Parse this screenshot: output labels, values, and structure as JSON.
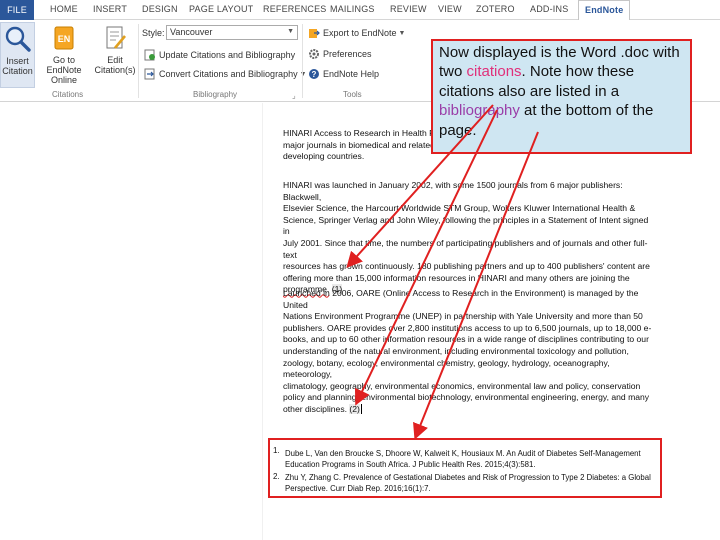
{
  "ribbon": {
    "tabs": [
      {
        "label": "FILE"
      },
      {
        "label": "HOME"
      },
      {
        "label": "INSERT"
      },
      {
        "label": "DESIGN"
      },
      {
        "label": "PAGE LAYOUT"
      },
      {
        "label": "REFERENCES"
      },
      {
        "label": "MAILINGS"
      },
      {
        "label": "REVIEW"
      },
      {
        "label": "VIEW"
      },
      {
        "label": "ZOTERO"
      },
      {
        "label": "ADD-INS"
      },
      {
        "label": "EndNote"
      }
    ],
    "insert_citation": "Insert Citation",
    "goto_endnote": "Go to EndNote Online",
    "edit_citation": "Edit Citation(s)",
    "citations_group": "Citations",
    "style_label": "Style:",
    "style_value": "Vancouver",
    "update_citations": "Update Citations and Bibliography",
    "convert_citations": "Convert Citations and Bibliography",
    "bibliography_group": "Bibliography",
    "export_endnote": "Export to EndNote",
    "preferences": "Preferences",
    "endnote_help": "EndNote Help",
    "tools_group": "Tools"
  },
  "document": {
    "para1_lines": [
      "HINARI Access to Research in Health Programme",
      "major journals in biomedical and related",
      "developing countries."
    ],
    "para2_lines": [
      "HINARI was launched in January 2002, with some 1500 journals from 6 major publishers: Blackwell,",
      "Elsevier Science, the Harcourt Worldwide STM Group, Wolters Kluwer International Health &",
      "Science, Springer Verlag and John Wiley, following the principles in a Statement of Intent signed in",
      "July 2001. Since that time, the numbers of participating publishers and of journals and other full-text",
      "resources has grown continuously. 180 publishing partners and up to 400 publishers' content are",
      "offering more than 15,000 information resources in HINARI and many others are joining the"
    ],
    "para2_last_word": "programme.",
    "citation1": "(1)",
    "para3_lines": [
      "Launched in 2006, OARE (Online Access to Research in the Environment) is managed by the United",
      "Nations Environment Programme (UNEP) in partnership with Yale University and more than 50",
      "publishers. OARE provides over 2,800 institutions access to up to 6,500 journals, up to 18,000 e-",
      "books, and up to 60 other information resources in a wide range of disciplines contributing to our",
      "understanding of the natural environment, including environmental toxicology and pollution,",
      "zoology, botany, ecology, environmental chemistry, geology, hydrology, oceanography, meteorology,",
      "climatology, geography, environmental economics, environmental law and policy, conservation",
      "policy and planning, environmental biotechnology, environmental engineering, energy, and many"
    ],
    "para3_last": "other disciplines.",
    "citation2": "(2)"
  },
  "bibliography": [
    {
      "num": "1.",
      "line1": "Dube L, Van den Broucke S, Dhoore W, Kalweit K, Housiaux M. An Audit of Diabetes Self-Management",
      "line2": "Education Programs in South Africa. J Public Health Res. 2015;4(3):581."
    },
    {
      "num": "2.",
      "line1": "Zhu Y, Zhang C. Prevalence of Gestational Diabetes and Risk of Progression to Type 2 Diabetes: a Global",
      "line2": "Perspective. Curr Diab Rep. 2016;16(1):7."
    }
  ],
  "callout": {
    "part1": "Now displayed is the Word .doc with two ",
    "citations": "citations",
    "part2": ".  Note how these citations also are listed in a ",
    "bibliography": "bibliography",
    "part3": " at the bottom of the page."
  },
  "colors": {
    "accent": "#2b579a",
    "annotation_red": "#e02020",
    "callout_bg": "#cfe6f2"
  }
}
